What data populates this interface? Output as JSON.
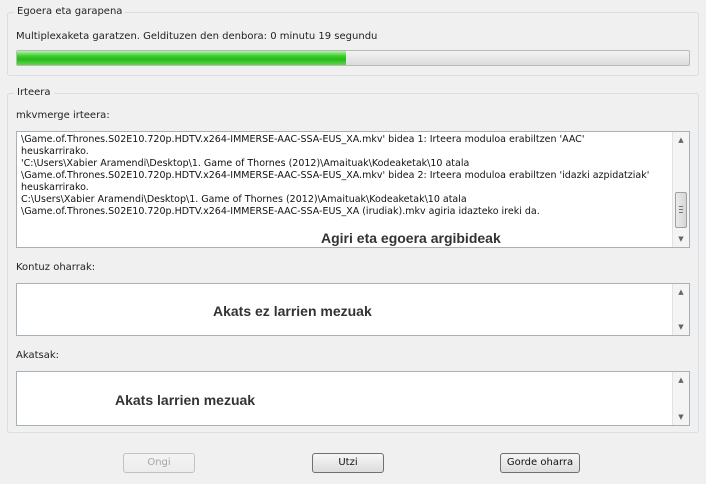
{
  "progress_group": {
    "title": "Egoera eta garapena",
    "status_text": "Multiplexaketa garatzen.  Geldituzen den denbora:  0 minutu 19 segundu",
    "progress_fraction": 0.49
  },
  "output_group": {
    "title": "Irteera",
    "log_label": "mkvmerge irteera:",
    "log_lines": [
      "\\Game.of.Thrones.S02E10.720p.HDTV.x264-IMMERSE-AAC-SSA-EUS_XA.mkv' bidea 1: Irteera moduloa erabiltzen 'AAC'",
      "heuskarrirako.",
      "'C:\\Users\\Xabier Aramendi\\Desktop\\1. Game of Thornes (2012)\\Amaituak\\Kodeaketak\\10 atala",
      "\\Game.of.Thrones.S02E10.720p.HDTV.x264-IMMERSE-AAC-SSA-EUS_XA.mkv' bidea 2: Irteera moduloa erabiltzen 'idazki azpidatziak'",
      "heuskarrirako.",
      "C:\\Users\\Xabier Aramendi\\Desktop\\1. Game of Thornes (2012)\\Amaituak\\Kodeaketak\\10 atala",
      "\\Game.of.Thrones.S02E10.720p.HDTV.x264-IMMERSE-AAC-SSA-EUS_XA (irudiak).mkv agiria idazteko ireki da."
    ],
    "log_overlay": "Agiri eta egoera argibideak",
    "warnings_label": "Kontuz oharrak:",
    "warnings_overlay": "Akats ez larrien mezuak",
    "errors_label": "Akatsak:",
    "errors_overlay": "Akats larrien mezuak"
  },
  "buttons": {
    "ok": "Ongi",
    "abort": "Utzi",
    "save_log": "Gorde oharra"
  }
}
